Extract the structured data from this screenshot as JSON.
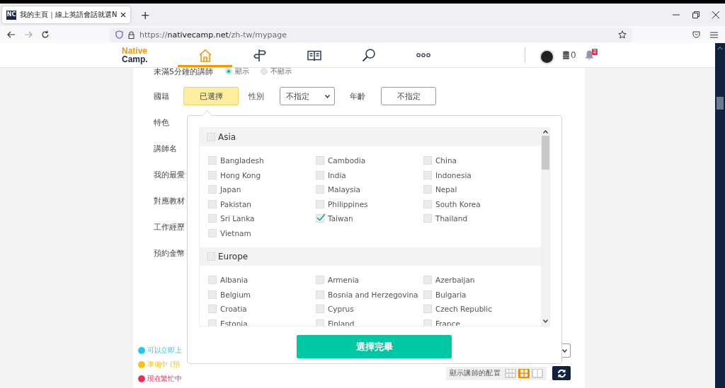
{
  "browser": {
    "tab": {
      "favicon": "NC",
      "title": "我的主頁｜線上英語會話就選N"
    },
    "new_tab": "+",
    "url": {
      "scheme": "https://",
      "domain": "nativecamp.net",
      "path": "/zh-tw/mypage"
    }
  },
  "header": {
    "logo": [
      "Native",
      "Camp."
    ],
    "nav": [
      {
        "kind": "home",
        "selected": true
      },
      {
        "kind": "signpost",
        "selected": false
      },
      {
        "kind": "book",
        "selected": false
      },
      {
        "kind": "search",
        "selected": false
      },
      {
        "kind": "more",
        "selected": false
      }
    ],
    "coins": "0",
    "notifications": "2"
  },
  "filters": {
    "short_lesson": {
      "label": "未滿5分鐘的講師",
      "options": [
        {
          "label": "顯示",
          "selected": true
        },
        {
          "label": "不顯示",
          "selected": false
        }
      ]
    },
    "nationality": {
      "label": "國籍",
      "value": "已選擇"
    },
    "gender": {
      "label": "性別",
      "value": "不指定"
    },
    "age": {
      "label": "年齡",
      "value": "不指定"
    },
    "labels": [
      "特色",
      "講師名",
      "我的最愛",
      "對應教材",
      "工作經歷",
      "預約金幣"
    ]
  },
  "country_popup": {
    "groups": [
      {
        "name": "Asia",
        "checked": false,
        "countries": [
          {
            "name": "Bangladesh",
            "checked": false
          },
          {
            "name": "Cambodia",
            "checked": false
          },
          {
            "name": "China",
            "checked": false
          },
          {
            "name": "Hong Kong",
            "checked": false
          },
          {
            "name": "India",
            "checked": false
          },
          {
            "name": "Indonesia",
            "checked": false
          },
          {
            "name": "Japan",
            "checked": false
          },
          {
            "name": "Malaysia",
            "checked": false
          },
          {
            "name": "Nepal",
            "checked": false
          },
          {
            "name": "Pakistan",
            "checked": false
          },
          {
            "name": "Philippines",
            "checked": false
          },
          {
            "name": "South Korea",
            "checked": false
          },
          {
            "name": "Sri Lanka",
            "checked": false
          },
          {
            "name": "Taiwan",
            "checked": true
          },
          {
            "name": "Thailand",
            "checked": false
          },
          {
            "name": "Vietnam",
            "checked": false
          }
        ]
      },
      {
        "name": "Europe",
        "checked": false,
        "countries": [
          {
            "name": "Albania",
            "checked": false
          },
          {
            "name": "Armenia",
            "checked": false
          },
          {
            "name": "Azerbaijan",
            "checked": false
          },
          {
            "name": "Belgium",
            "checked": false
          },
          {
            "name": "Bosnia and Herzegovina",
            "checked": false
          },
          {
            "name": "Bulgaria",
            "checked": false
          },
          {
            "name": "Croatia",
            "checked": false
          },
          {
            "name": "Cyprus",
            "checked": false
          },
          {
            "name": "Czech Republic",
            "checked": false
          },
          {
            "name": "Estonia",
            "checked": false
          },
          {
            "name": "Finland",
            "checked": false
          },
          {
            "name": "France",
            "checked": false
          }
        ]
      }
    ],
    "done_button": "選擇完畢"
  },
  "legend": [
    {
      "label": "可以立即上",
      "color": "#1ec8f0"
    },
    {
      "label": "準備中 (預",
      "color": "#f5c211"
    },
    {
      "label": "現在繁忙中",
      "color": "#e8305a"
    }
  ],
  "layout_switch": {
    "label": "顯示講師的配置",
    "options": [
      {
        "kind": "compact",
        "selected": false
      },
      {
        "kind": "grid",
        "selected": true
      },
      {
        "kind": "wide",
        "selected": false
      }
    ]
  }
}
